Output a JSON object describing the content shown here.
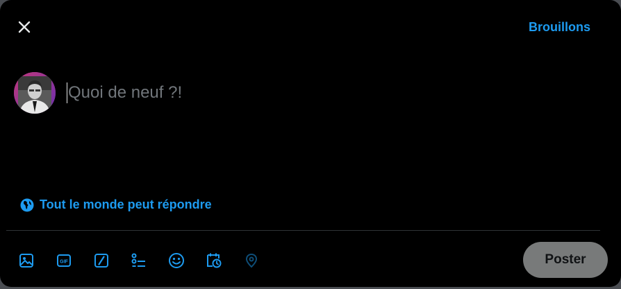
{
  "header": {
    "close_icon": "close-icon",
    "drafts_label": "Brouillons"
  },
  "composer": {
    "avatar_icon": "user-avatar",
    "placeholder": "Quoi de neuf ?!"
  },
  "reply_setting": {
    "icon": "globe-icon",
    "label": "Tout le monde peut répondre"
  },
  "toolbar": {
    "tools": [
      {
        "name": "media-icon"
      },
      {
        "name": "gif-icon",
        "label": "GIF"
      },
      {
        "name": "grok-icon"
      },
      {
        "name": "poll-icon"
      },
      {
        "name": "emoji-icon"
      },
      {
        "name": "schedule-icon"
      },
      {
        "name": "location-icon"
      }
    ],
    "post_label": "Poster"
  },
  "colors": {
    "accent": "#1d9bf0",
    "background": "#000000",
    "post_button_disabled": "#787a7a",
    "placeholder_text": "#71767b"
  }
}
